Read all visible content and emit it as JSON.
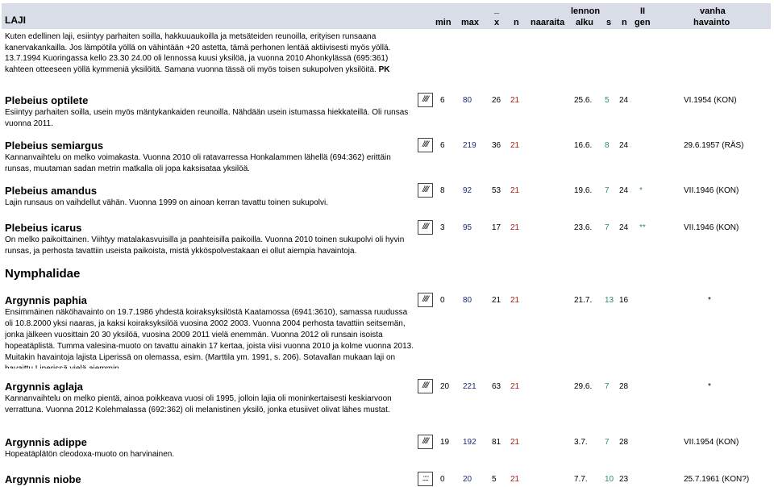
{
  "header": {
    "laji": "LAJI",
    "min": "min",
    "max": "max",
    "x_top": "_",
    "x": "x",
    "n1": "n",
    "naaraita": "naaraita",
    "lennon": "lennon",
    "alku": "alku",
    "s": "s",
    "n2": "n",
    "ii": "II",
    "gen": "gen",
    "vanha": "vanha",
    "havainto": "havainto"
  },
  "intro": {
    "line1": "Kuten edellinen laji, esiintyy parhaiten soilla, hakkuuaukoilla ja metsäteiden reunoilla, erityisen runsaana kanervakankailla. Jos lämpötila yöllä on vähintään +20 astetta, tämä perhonen lentää aktiivisesti myös yöllä. 13.7.1994 Kuoringassa kello 23.30 24.00 oli lennossa kuusi yksilöä, ja vuonna 2010 Ahonkylässä (695:361) kahteen otteeseen yöllä kymmeniä yksilöitä. Samana vuonna tässä oli myös toisen sukupolven yksilöitä.",
    "tag": "PK"
  },
  "family": "Nymphalidae",
  "species": [
    {
      "name": "Plebeius optilete",
      "bar": "////",
      "min": "6",
      "max": "80",
      "x": "26",
      "naaraita": "21",
      "alku": "25.6.",
      "s": "5",
      "n": "24",
      "gen": "",
      "vanha": "VI.1954 (KON)",
      "desc": "Esiintyy parhaiten soilla, usein myös mäntykankaiden reunoilla. Nähdään usein istumassa hiekkateillä. Oli runsas vuonna 2011."
    },
    {
      "name": "Plebeius semiargus",
      "bar": "////",
      "min": "6",
      "max": "219",
      "x": "36",
      "naaraita": "21",
      "alku": "16.6.",
      "s": "8",
      "n": "24",
      "gen": "",
      "vanha": "29.6.1957 (RÄS)",
      "desc": "Kannanvaihtelu on melko voimakasta. Vuonna 2010 oli ratavarressa Honkalammen lähellä (694:362) erittäin runsas, muutaman sadan metrin matkalla oli jopa kaksisataa yksilöä."
    },
    {
      "name": "Plebeius amandus",
      "bar": "////",
      "min": "8",
      "max": "92",
      "x": "53",
      "naaraita": "21",
      "alku": "19.6.",
      "s": "7",
      "n": "24",
      "gen": "*",
      "vanha": "VII.1946 (KON)",
      "desc": "Lajin runsaus on vaihdellut vähän. Vuonna 1999 on ainoan kerran tavattu toinen sukupolvi."
    },
    {
      "name": "Plebeius icarus",
      "bar": "////",
      "min": "3",
      "max": "95",
      "x": "17",
      "naaraita": "21",
      "alku": "23.6.",
      "s": "7",
      "n": "24",
      "gen": "**",
      "vanha": "VII.1946 (KON)",
      "desc": "On melko paikoittainen. Viihtyy matalakasvuisilla ja paahteisilla paikoilla. Vuonna 2010 toinen sukupolvi oli hyvin runsas, ja perhosta tavattiin useista paikoista, mistä ykköspolvestakaan ei ollut aiempia havaintoja."
    },
    {
      "name": "Argynnis paphia",
      "bar": "////",
      "min": "0",
      "max": "80",
      "x": "21",
      "naaraita": "21",
      "alku": "21.7.",
      "s": "13",
      "n": "16",
      "gen": "",
      "vanha": "*",
      "desc": "Ensimmäinen näköhavainto on 19.7.1986 yhdestä koiraksyksilöstä Kaatamossa (6941:3610), samassa ruudussa oli 10.8.2000 yksi naaras, ja kaksi koiraksyksilöä vuosina 2002 2003. Vuonna 2004 perhosta tavattiin seitsemän, jonka jälkeen vuosittain 20 30 yksilöä, vuosina 2009 2011 vielä enemmän. Vuonna 2012 oli runsain isoista hopeatäplistä. Tumma valesina-muoto on tavattu ainakin 17 kertaa, joista viisi vuonna 2010 ja kolme vuonna 2013. Muitakin havaintoja lajista Liperissä on olemassa, esim. (Marttila ym. 1991, s. 206). Sotavallan mukaan laji on havaittu Liperissä vielä aiemmin."
    },
    {
      "name": "Argynnis aglaja",
      "bar": "////",
      "min": "20",
      "max": "221",
      "x": "63",
      "naaraita": "21",
      "alku": "29.6.",
      "s": "7",
      "n": "28",
      "gen": "",
      "vanha": "*",
      "desc": "Kannanvaihtelu on melko pientä, ainoa poikkeava vuosi oli 1995, jolloin lajia oli moninkertaisesti keskiarvoon verrattuna. Vuonna 2012 Kolehmalassa (692:362) oli melanistinen yksilö, jonka etusiivet olivat lähes mustat."
    },
    {
      "name": "Argynnis adippe",
      "bar": "////",
      "min": "19",
      "max": "192",
      "x": "81",
      "naaraita": "21",
      "alku": "3.7.",
      "s": "7",
      "n": "28",
      "gen": "",
      "vanha": "VII.1954 (KON)",
      "desc": "Hopeatäplätön cleodoxa-muoto on harvinainen."
    },
    {
      "name": "Argynnis niobe",
      "bar": "::::",
      "min": "0",
      "max": "20",
      "x": "5",
      "naaraita": "21",
      "alku": "7.7.",
      "s": "10",
      "n": "23",
      "gen": "",
      "vanha": "25.7.1961 (KON?)",
      "desc": ""
    }
  ]
}
